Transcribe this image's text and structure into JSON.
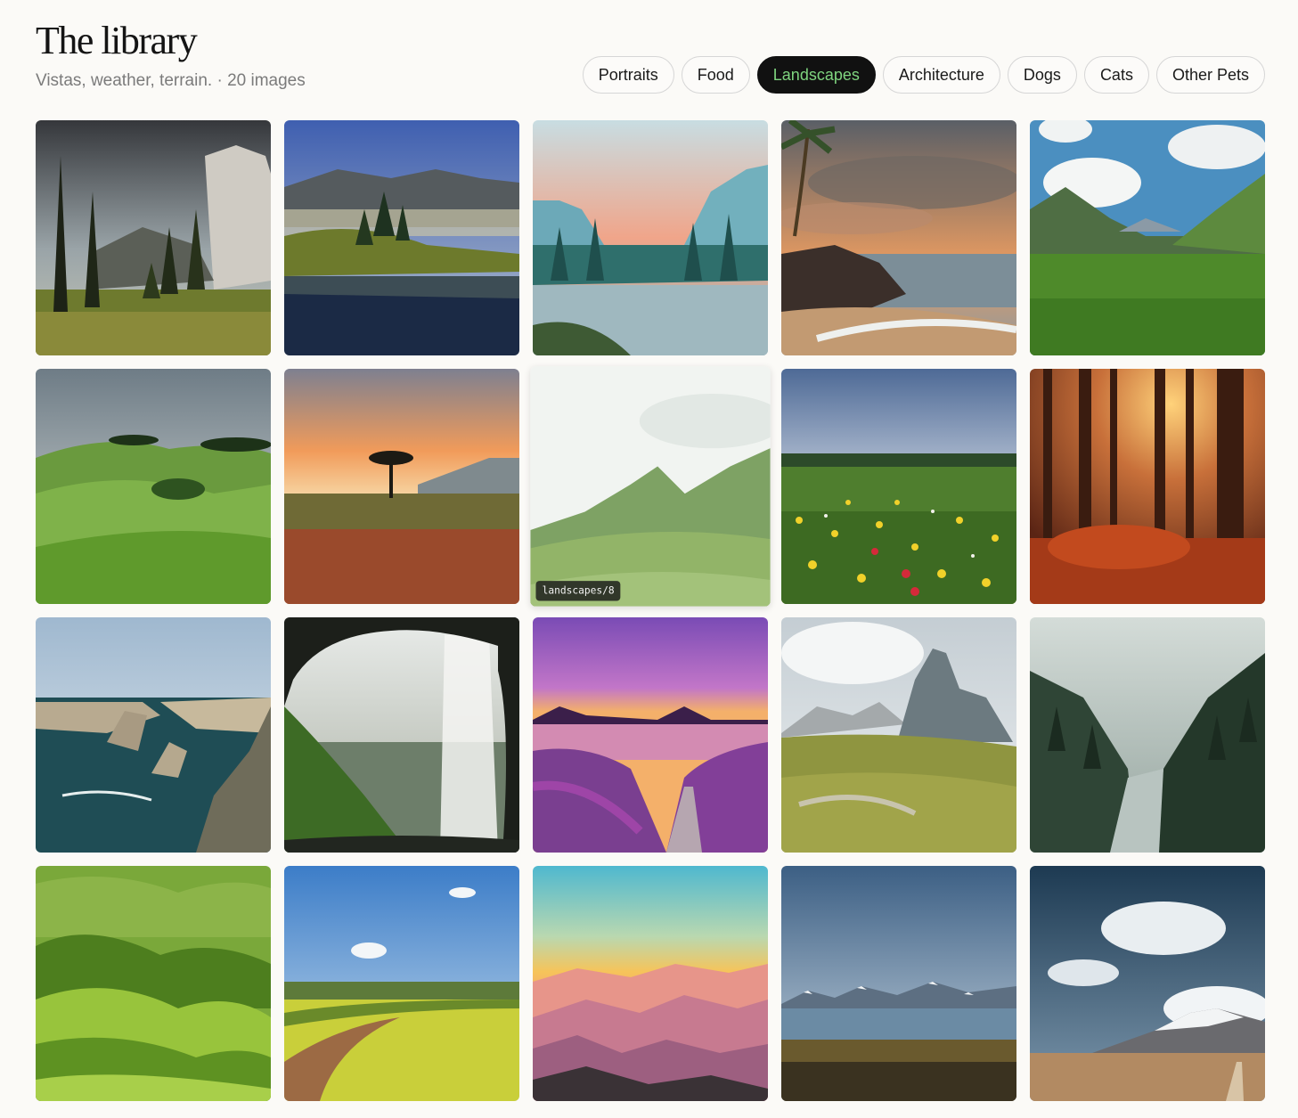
{
  "header": {
    "title": "The library",
    "subtitle": "Vistas, weather, terrain. · 20 images"
  },
  "filters": [
    {
      "label": "Portraits",
      "active": false
    },
    {
      "label": "Food",
      "active": false
    },
    {
      "label": "Landscapes",
      "active": true
    },
    {
      "label": "Architecture",
      "active": false
    },
    {
      "label": "Dogs",
      "active": false
    },
    {
      "label": "Cats",
      "active": false
    },
    {
      "label": "Other Pets",
      "active": false
    }
  ],
  "gallery": {
    "hover_label": "landscapes/8",
    "images": [
      {
        "scene": "granite cliff and pine trees in a sunlit valley"
      },
      {
        "scene": "misty mountains reflected in a calm pond"
      },
      {
        "scene": "pastel canyon cliffs above a forest river"
      },
      {
        "scene": "stormy sunset over a rocky tropical beach with palm"
      },
      {
        "scene": "green mountain valley under puffy clouds"
      },
      {
        "scene": "rolling green hills with scattered trees"
      },
      {
        "scene": "orange savanna sunset with a lone acacia tree"
      },
      {
        "scene": "soft green hills under a white misty sky"
      },
      {
        "scene": "wildflower meadow under a dramatic blue sky"
      },
      {
        "scene": "autumn forest with sun rays through trees"
      },
      {
        "scene": "coastal sea stacks and rocky cliffs"
      },
      {
        "scene": "waterfall seen from behind inside a cave"
      },
      {
        "scene": "purple sunset over a lake with lavender field path"
      },
      {
        "scene": "rugged mountain peak above a grassy plateau"
      },
      {
        "scene": "foggy forested valley with a rocky stream"
      },
      {
        "scene": "bright green rolling ridges"
      },
      {
        "scene": "dirt road through yellow rapeseed fields"
      },
      {
        "scene": "layered pink mountain ridges at sunrise"
      },
      {
        "scene": "snowy mountain range beyond a lake"
      },
      {
        "scene": "desert plain with snowy volcano and big clouds"
      }
    ]
  }
}
